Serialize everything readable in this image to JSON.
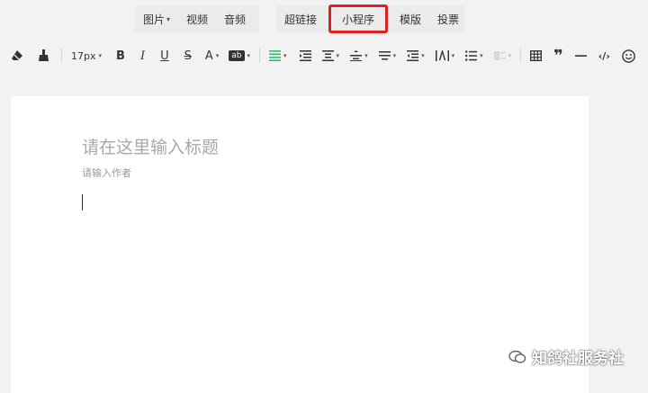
{
  "insert_bar": {
    "image": "图片",
    "video": "视频",
    "audio": "音频",
    "hyperlink": "超链接",
    "mini_program": "小程序",
    "template": "模版",
    "vote": "投票"
  },
  "toolbar": {
    "font_size": "17px",
    "bold": "B",
    "italic": "I",
    "underline": "U",
    "strike": "S",
    "font_color": "A",
    "bg_color": "ab",
    "accent_color": "#2fbd6b"
  },
  "editor": {
    "title_placeholder": "请在这里输入标题",
    "author_placeholder": "请输入作者"
  },
  "watermark": {
    "text": "知鸽社服务社"
  },
  "colors": {
    "highlight_border": "#e02020",
    "page_bg": "#ffffff",
    "app_bg": "#f2f2f2"
  }
}
